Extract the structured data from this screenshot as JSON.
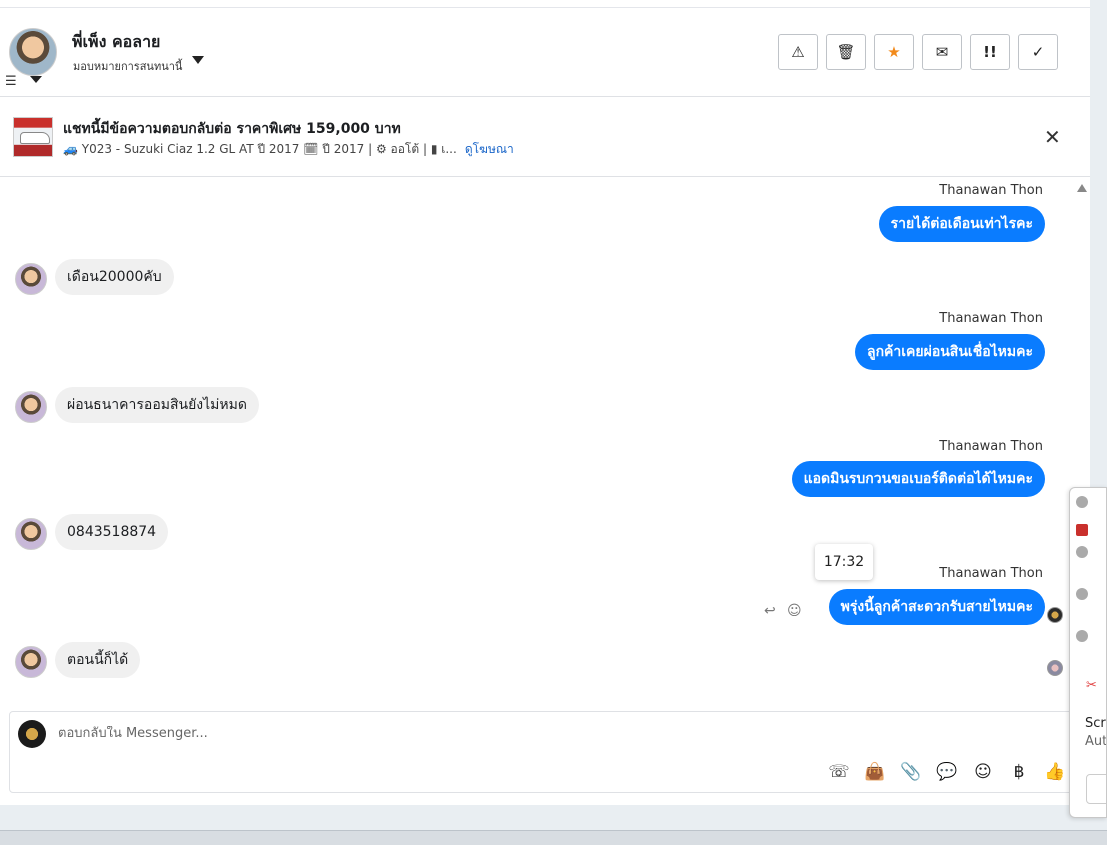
{
  "header": {
    "contact_name": "พี่เพ็ง คอลาย",
    "assign_label": "มอบหมายการสนทนานี้",
    "actions": [
      {
        "icon": "warning-icon",
        "glyph": "⚠"
      },
      {
        "icon": "trash-icon",
        "glyph": "🗑"
      },
      {
        "icon": "star-icon",
        "glyph": "★"
      },
      {
        "icon": "envelope-icon",
        "glyph": "✉"
      },
      {
        "icon": "follow-up-icon",
        "glyph": "!!"
      },
      {
        "icon": "check-icon",
        "glyph": "✓"
      }
    ]
  },
  "banner": {
    "title": "แชทนี้มีข้อความตอบกลับต่อ ราคาพิเศษ 159,000 บาท",
    "subtitle": "🚙 Y023 - Suzuki Ciaz 1.2 GL AT ปี 2017 🗓 ปี 2017 | ⚙ ออโต้ | ▮ เ...",
    "link": "ดูโฆษณา",
    "close_glyph": "✕"
  },
  "messages": [
    {
      "dir": "out",
      "sender": "Thanawan Thon",
      "text": "รายได้ต่อเดือนเท่าไรคะ"
    },
    {
      "dir": "in",
      "text": "เดือน20000คับ"
    },
    {
      "dir": "out",
      "sender": "Thanawan Thon",
      "text": "ลูกค้าเคยผ่อนสินเชื่อไหมคะ"
    },
    {
      "dir": "in",
      "text": "ผ่อนธนาคารออมสินยังไม่หมด"
    },
    {
      "dir": "out",
      "sender": "Thanawan Thon",
      "text": "แอดมินรบกวนขอเบอร์ติดต่อได้ไหมคะ"
    },
    {
      "dir": "in",
      "text": "0843518874"
    },
    {
      "dir": "out",
      "sender": "Thanawan Thon",
      "text": "พรุ่งนี้ลูกค้าสะดวกรับสายไหมคะ"
    },
    {
      "dir": "in",
      "text": "ตอนนี้ก็ได้"
    }
  ],
  "tooltip_time": "17:32",
  "composer": {
    "placeholder": "ตอบกลับใน Messenger...",
    "icons": [
      {
        "name": "call-add-icon",
        "glyph": "☏"
      },
      {
        "name": "shopping-bag-icon",
        "glyph": "👜"
      },
      {
        "name": "attach-icon",
        "glyph": "📎"
      },
      {
        "name": "saved-reply-icon",
        "glyph": "💬"
      },
      {
        "name": "emoji-icon",
        "glyph": "☺"
      },
      {
        "name": "baht-icon",
        "glyph": "฿"
      },
      {
        "name": "like-icon",
        "glyph": "👍"
      }
    ]
  },
  "side_panel": {
    "text1": "Scre",
    "text2": "Aut"
  }
}
